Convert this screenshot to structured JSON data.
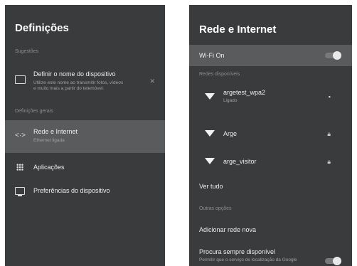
{
  "left": {
    "title": "Definições",
    "suggestions_header": "Sugestões",
    "suggestion": {
      "title": "Definir o nome do dispositivo",
      "subtitle_line1": "Utilize este nome ao transmitir fotos, vídeos",
      "subtitle_line2": "e muito mais a partir do telemóvel.",
      "icon": "cast-icon"
    },
    "general_header": "Definições gerais",
    "items": [
      {
        "label": "Rede e Internet",
        "subtitle": "Ethernet ligada",
        "icon": "network-icon"
      },
      {
        "label": "Aplicações",
        "icon": "apps-grid-icon"
      },
      {
        "label": "Preferências do dispositivo",
        "icon": "monitor-icon"
      }
    ]
  },
  "right": {
    "title": "Rede e Internet",
    "wifi_toggle_label": "Wi-Fi On",
    "available_header": "Redes disponíveis",
    "networks": [
      {
        "name": "argetest_wpa2",
        "status": "Ligado",
        "secured": true
      },
      {
        "name": "Arge",
        "secured": true
      },
      {
        "name": "arge_visitor",
        "secured": true
      }
    ],
    "see_all": "Ver tudo",
    "other_header": "Outras opções",
    "add_network": "Adicionar rede nova",
    "scan_always": {
      "label": "Procura sempre disponível",
      "subtitle": "Permitir que o serviço de localização da Google"
    }
  },
  "colors": {
    "panel_bg": "#3a3b3d",
    "highlight_bg": "#5a5b5d",
    "text_primary": "#ededed",
    "text_secondary": "#9fa1a3"
  }
}
